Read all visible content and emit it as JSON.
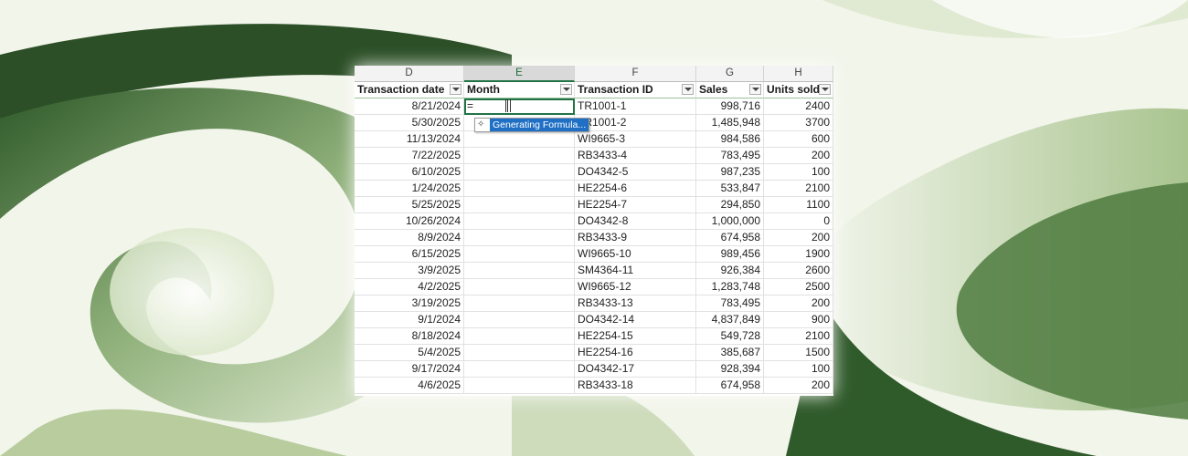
{
  "columns": {
    "letters": [
      "D",
      "E",
      "F",
      "G",
      "H"
    ],
    "selected_index": 1
  },
  "table": {
    "headers": [
      "Transaction date",
      "Month",
      "Transaction ID",
      "Sales",
      "Units sold"
    ],
    "rows": [
      [
        "8/21/2024",
        "=",
        "TR1001-1",
        "998,716",
        "2400"
      ],
      [
        "5/30/2025",
        "",
        "TR1001-2",
        "1,485,948",
        "3700"
      ],
      [
        "11/13/2024",
        "",
        "WI9665-3",
        "984,586",
        "600"
      ],
      [
        "7/22/2025",
        "",
        "RB3433-4",
        "783,495",
        "200"
      ],
      [
        "6/10/2025",
        "",
        "DO4342-5",
        "987,235",
        "100"
      ],
      [
        "1/24/2025",
        "",
        "HE2254-6",
        "533,847",
        "2100"
      ],
      [
        "5/25/2025",
        "",
        "HE2254-7",
        "294,850",
        "1100"
      ],
      [
        "10/26/2024",
        "",
        "DO4342-8",
        "1,000,000",
        "0"
      ],
      [
        "8/9/2024",
        "",
        "RB3433-9",
        "674,958",
        "200"
      ],
      [
        "6/15/2025",
        "",
        "WI9665-10",
        "989,456",
        "1900"
      ],
      [
        "3/9/2025",
        "",
        "SM4364-11",
        "926,384",
        "2600"
      ],
      [
        "4/2/2025",
        "",
        "WI9665-12",
        "1,283,748",
        "2500"
      ],
      [
        "3/19/2025",
        "",
        "RB3433-13",
        "783,495",
        "200"
      ],
      [
        "9/1/2024",
        "",
        "DO4342-14",
        "4,837,849",
        "900"
      ],
      [
        "8/18/2024",
        "",
        "HE2254-15",
        "549,728",
        "2100"
      ],
      [
        "5/4/2025",
        "",
        "HE2254-16",
        "385,687",
        "1500"
      ],
      [
        "9/17/2024",
        "",
        "DO4342-17",
        "928,394",
        "100"
      ],
      [
        "4/6/2025",
        "",
        "RB3433-18",
        "674,958",
        "200"
      ]
    ]
  },
  "tooltip": {
    "icon": "sparkle-icon",
    "label": "Generating Formula..."
  },
  "colors": {
    "accent": "#217346",
    "tooltip_bg": "#1f6fc5"
  }
}
